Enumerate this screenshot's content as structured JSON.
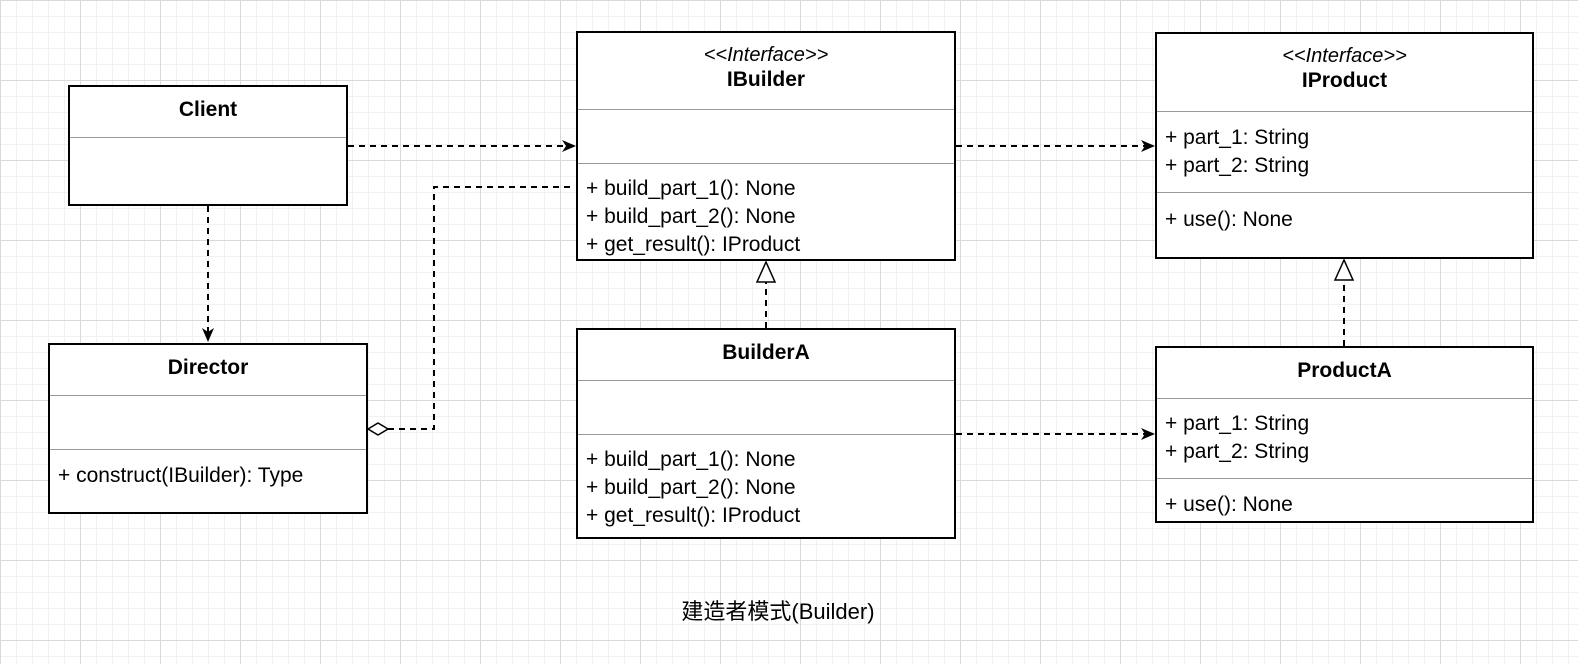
{
  "classes": {
    "client": {
      "name": "Client"
    },
    "director": {
      "name": "Director",
      "methods": [
        "+ construct(IBuilder): Type"
      ]
    },
    "ibuilder": {
      "stereotype": "<<Interface>>",
      "name": "IBuilder",
      "methods": [
        "+ build_part_1(): None",
        "+ build_part_2(): None",
        "+ get_result(): IProduct"
      ]
    },
    "builderA": {
      "name": "BuilderA",
      "methods": [
        "+ build_part_1(): None",
        "+ build_part_2(): None",
        "+ get_result(): IProduct"
      ]
    },
    "iproduct": {
      "stereotype": "<<Interface>>",
      "name": "IProduct",
      "attributes": [
        "+ part_1: String",
        "+ part_2: String"
      ],
      "methods": [
        "+ use(): None"
      ]
    },
    "productA": {
      "name": "ProductA",
      "attributes": [
        "+ part_1: String",
        "+ part_2: String"
      ],
      "methods": [
        "+ use(): None"
      ]
    }
  },
  "caption": "建造者模式(Builder)"
}
